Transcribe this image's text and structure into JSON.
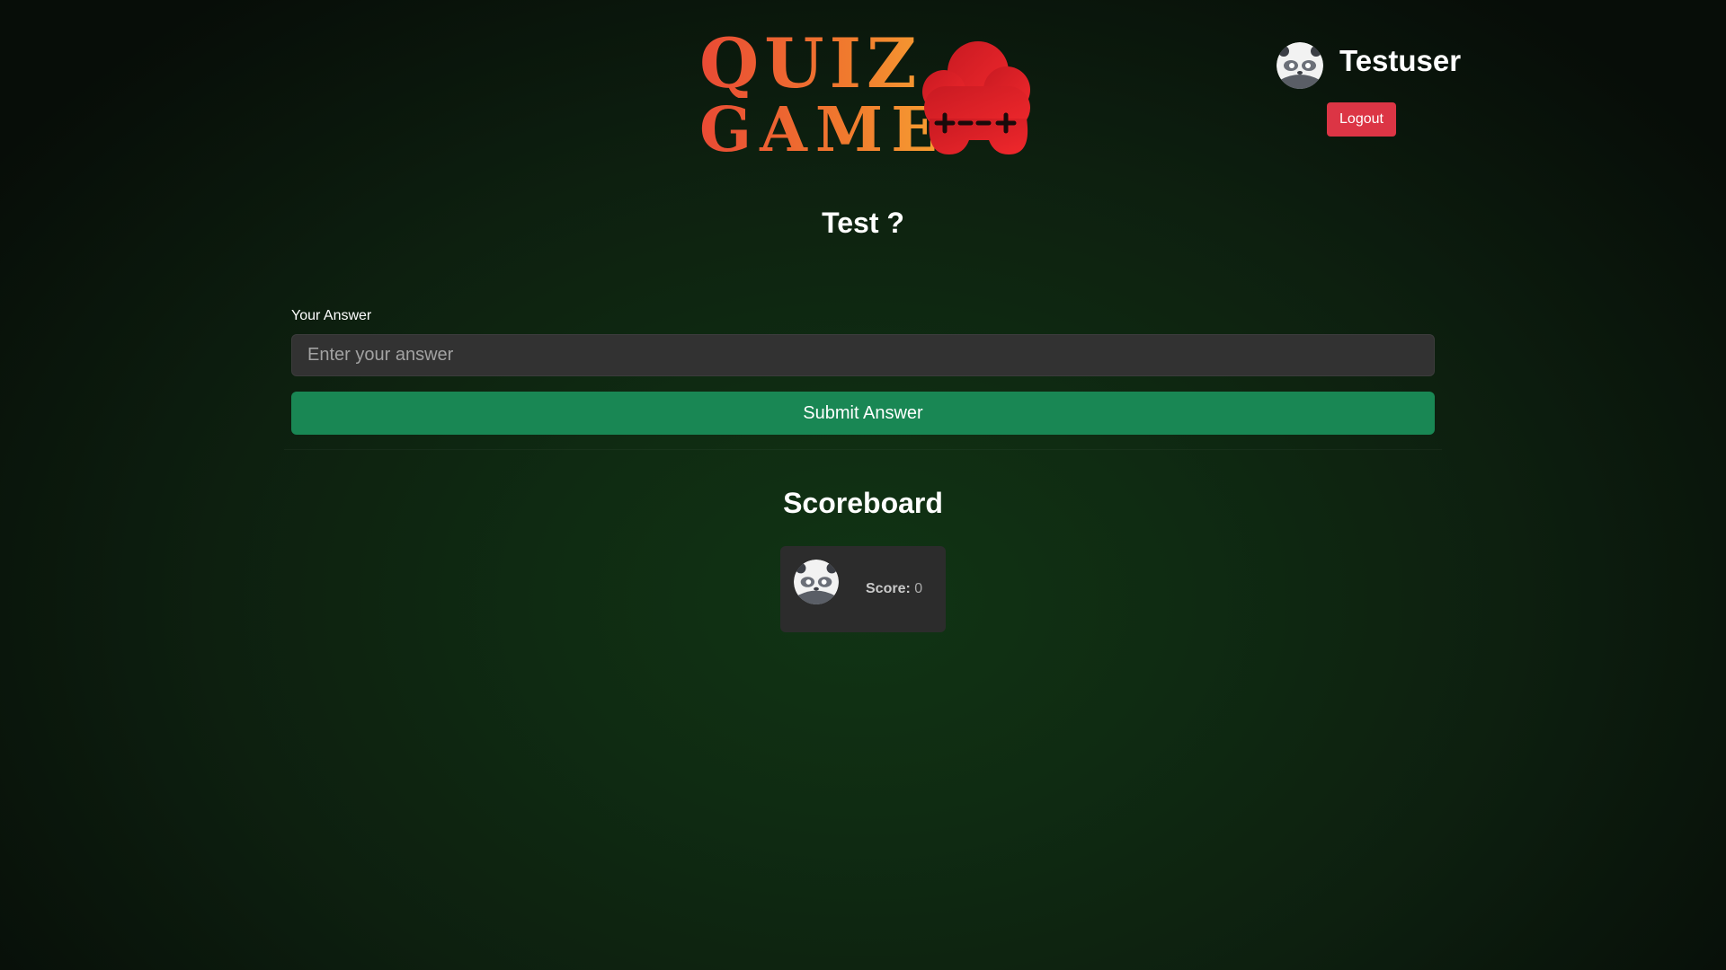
{
  "header": {
    "logo": {
      "line1": "QUIZ",
      "line2": "GAME",
      "icon": "gamepad-cloud-icon",
      "colors": {
        "text_start": "#e94a35",
        "text_end": "#f7a131",
        "icon": "#e41e26"
      }
    },
    "user": {
      "name": "Testuser",
      "avatar": "panda-avatar-icon",
      "logout_label": "Logout"
    }
  },
  "question": {
    "text": "Test ?"
  },
  "answer_form": {
    "label": "Your Answer",
    "input_value": "",
    "input_placeholder": "Enter your answer",
    "submit_label": "Submit Answer"
  },
  "scoreboard": {
    "title": "Scoreboard",
    "entries": [
      {
        "avatar": "panda-avatar-icon",
        "score_label": "Score:",
        "score_value": "0"
      }
    ]
  },
  "colors": {
    "logout": "#dc3545",
    "submit": "#198754",
    "background": "#0f2b12",
    "input_bg": "#323232",
    "card_bg": "#2c2c2c"
  }
}
